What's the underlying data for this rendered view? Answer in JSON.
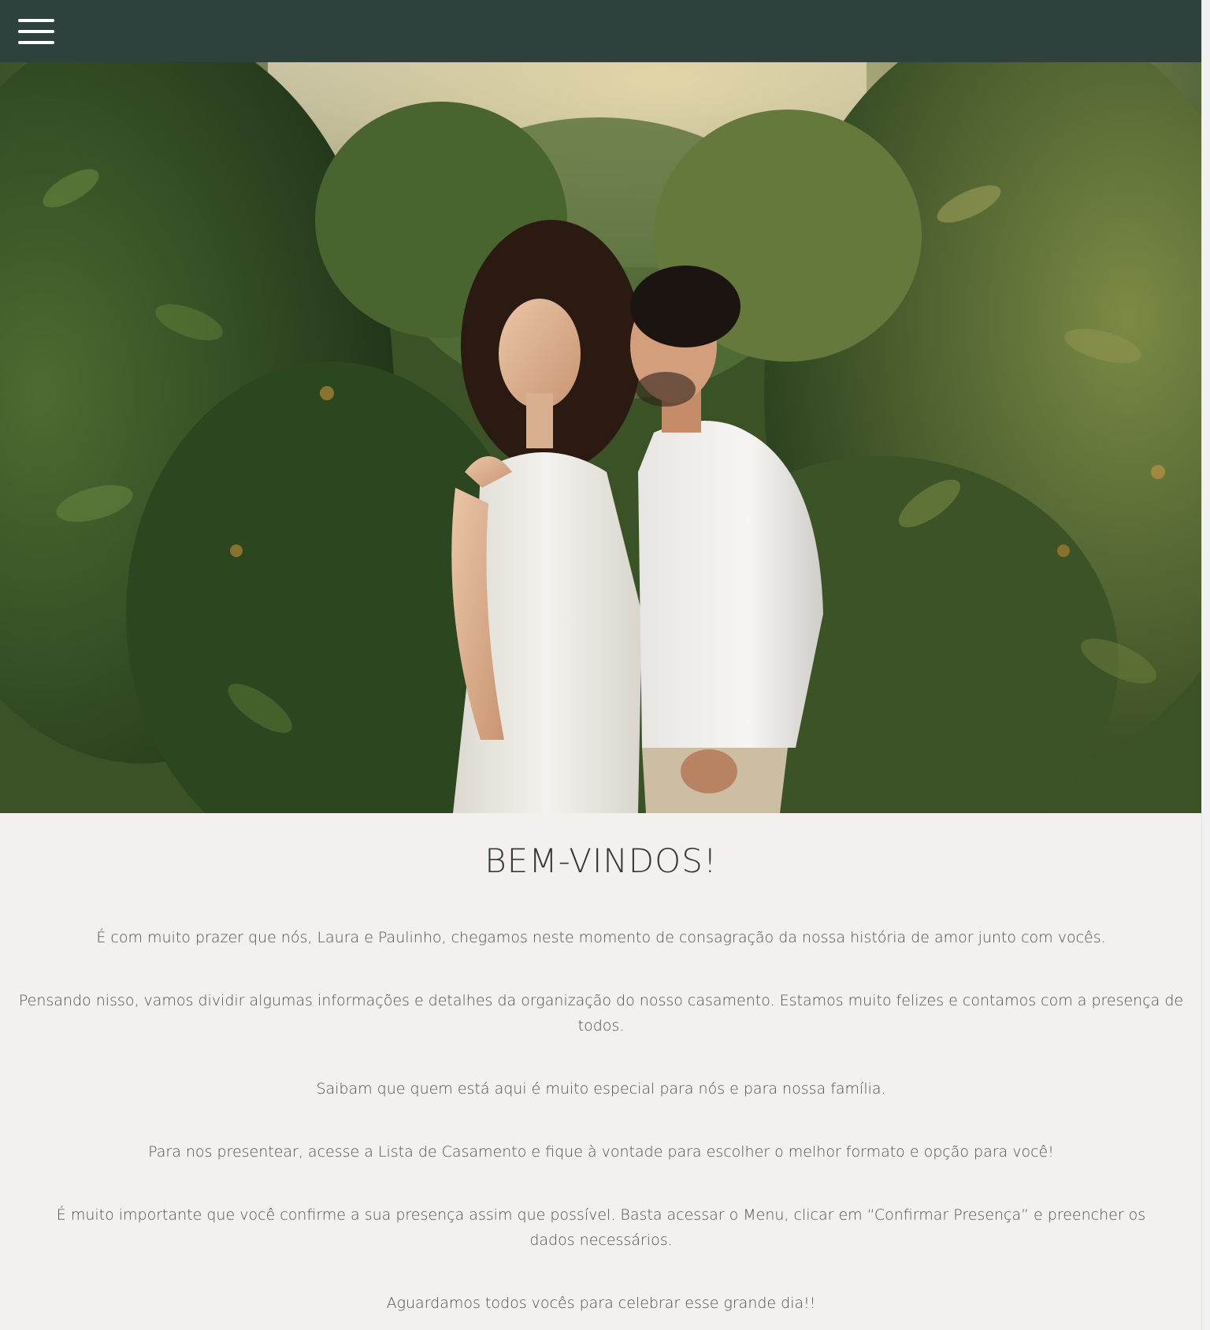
{
  "header": {
    "menu_icon": "hamburger-menu-icon",
    "background": "#2f413d"
  },
  "hero": {
    "image": "couple-photo-garden"
  },
  "welcome": {
    "title": "BEM-VINDOS!",
    "paragraphs": [
      "É com muito prazer que nós, Laura e Paulinho, chegamos neste momento de consagração da nossa história de amor junto com vocês.",
      "Pensando nisso, vamos dividir algumas informações e detalhes da organização do nosso casamento. Estamos muito felizes e contamos com a presença de todos.",
      "Saibam que quem está aqui é muito especial para nós e para nossa família.",
      "Para nos presentear, acesse a Lista de Casamento e fique à vontade para escolher o melhor formato e opção para você!",
      "É muito importante que você confirme a sua presença assim que possível. Basta acessar o Menu, clicar em “Confirmar Presença” e preencher os dados necessários.",
      "Aguardamos todos vocês para celebrar esse grande dia!!"
    ]
  },
  "colors": {
    "page_background": "#f3f0ed",
    "title_color": "#333a39",
    "text_color": "#505050"
  }
}
